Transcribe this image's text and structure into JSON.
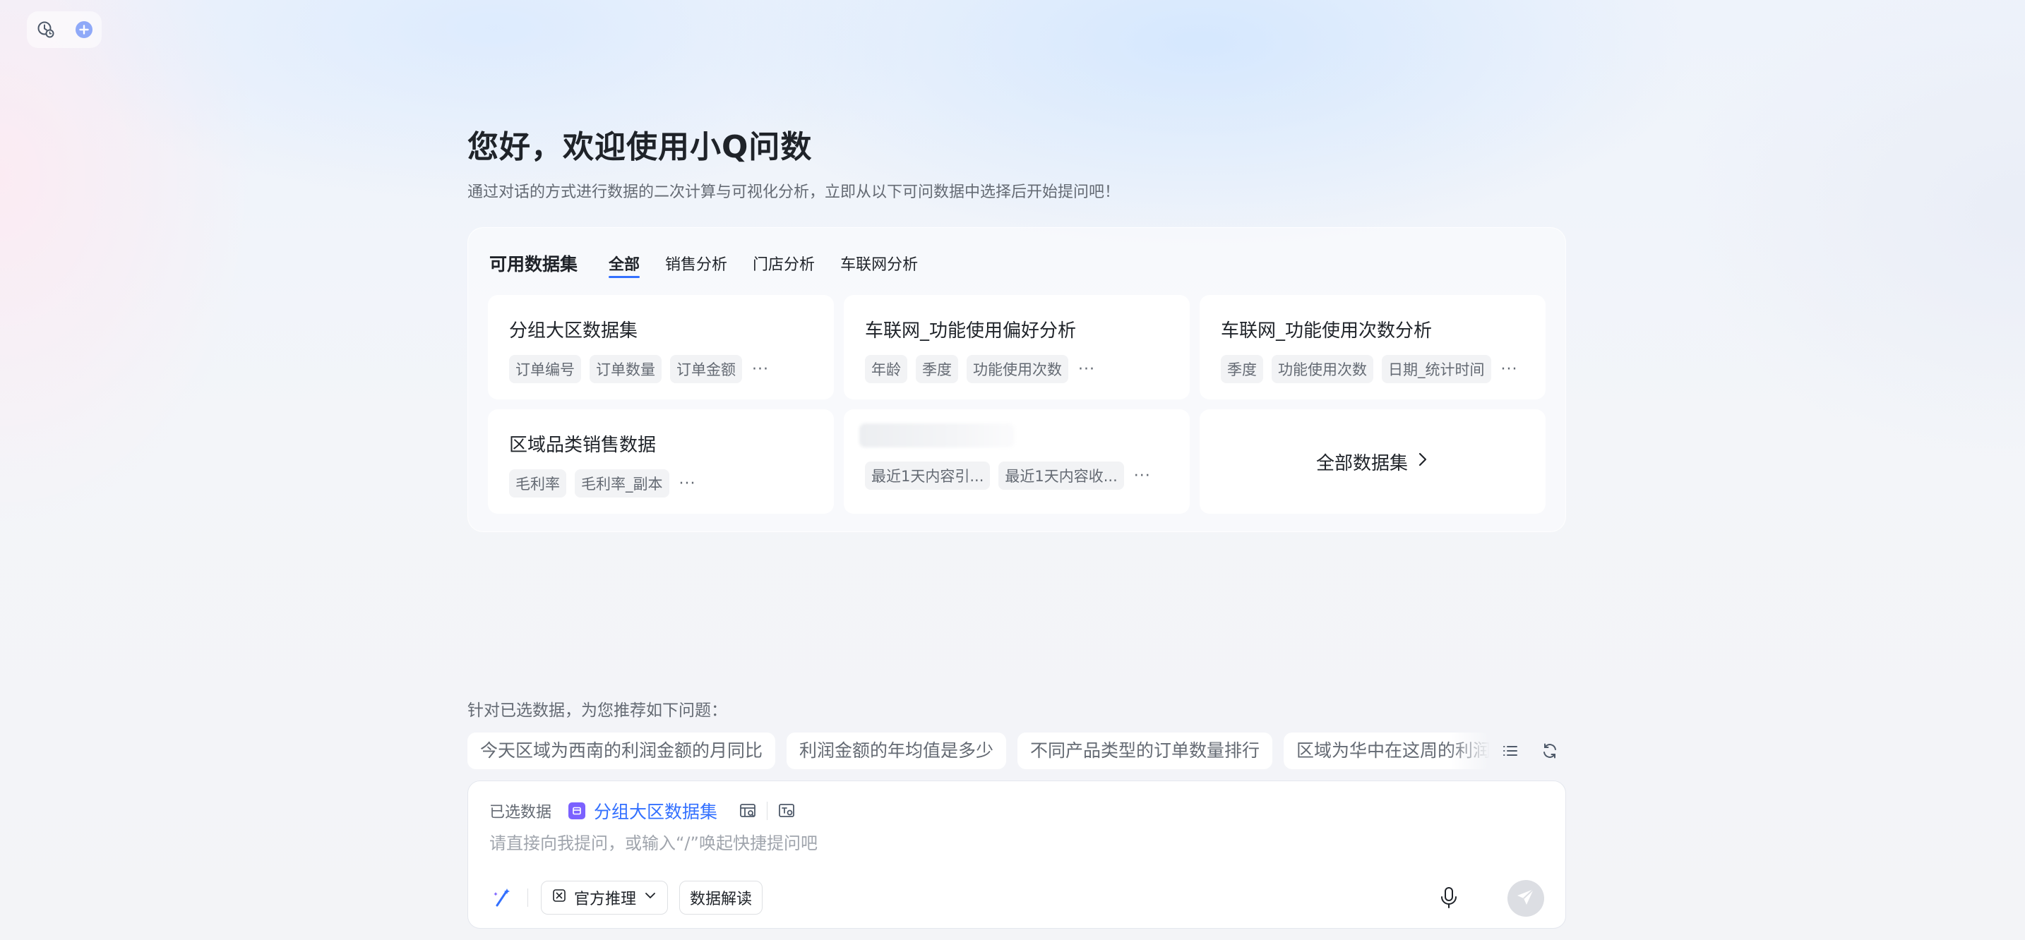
{
  "greeting": "您好，欢迎使用小Q问数",
  "subtitle": "通过对话的方式进行数据的二次计算与可视化分析，立即从以下可问数据中选择后开始提问吧！",
  "datasets_panel": {
    "title": "可用数据集",
    "tabs": [
      {
        "label": "全部",
        "active": true
      },
      {
        "label": "销售分析",
        "active": false
      },
      {
        "label": "门店分析",
        "active": false
      },
      {
        "label": "车联网分析",
        "active": false
      }
    ],
    "cards": [
      {
        "name": "分组大区数据集",
        "tags": [
          "订单编号",
          "订单数量",
          "订单金额"
        ],
        "more": "···"
      },
      {
        "name": "车联网_功能使用偏好分析",
        "tags": [
          "年龄",
          "季度",
          "功能使用次数"
        ],
        "more": "···"
      },
      {
        "name": "车联网_功能使用次数分析",
        "tags": [
          "季度",
          "功能使用次数",
          "日期_统计时间"
        ],
        "more": "···"
      },
      {
        "name": "区域品类销售数据",
        "tags": [
          "毛利率",
          "毛利率_副本"
        ],
        "more": "···"
      },
      {
        "name": "",
        "tags": [
          "最近1天内容引...",
          "最近1天内容收..."
        ],
        "more": "···"
      }
    ],
    "all_datasets_label": "全部数据集"
  },
  "recommend": {
    "title": "针对已选数据，为您推荐如下问题：",
    "questions": [
      "今天区域为西南的利润金额的月同比",
      "利润金额的年均值是多少",
      "不同产品类型的订单数量排行",
      "区域为华中在这周的利润"
    ]
  },
  "input": {
    "selected_label": "已选数据",
    "selected_dataset": "分组大区数据集",
    "placeholder": "请直接向我提问，或输入“/”唤起快捷提问吧",
    "mode_label": "官方推理",
    "interpret_label": "数据解读"
  },
  "colors": {
    "accent": "#3370ff",
    "dataset_icon": "#7b61ff",
    "send_disabled": "#dcdee3"
  },
  "icons": [
    "history-icon",
    "new-chat-icon",
    "chevron-right-icon",
    "list-icon",
    "refresh-icon",
    "dataset-icon",
    "table-preview-icon",
    "field-info-icon",
    "magic-wand-icon",
    "reasoning-icon",
    "chevron-down-icon",
    "microphone-icon",
    "send-icon"
  ]
}
